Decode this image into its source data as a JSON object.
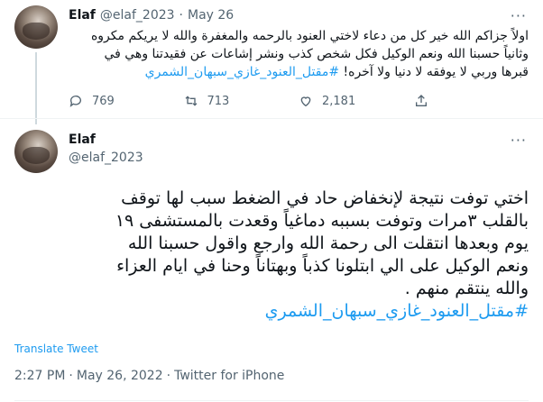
{
  "context_tweet": {
    "author_name": "Elaf",
    "handle": "@elaf_2023",
    "separator": "·",
    "date": "May 26",
    "more": "···",
    "lines": [
      "اولاً جزاكم الله خير كل من دعاء لاختي العنود بالرحمه والمغفرة والله لا يريكم مكروه",
      "وثانياً حسبنا الله ونعم الوكيل فكل شخص كذب ونشر إشاعات عن فقيدتنا وهي في",
      "قبرها وربي لا يوفقه لا دنيا ولا آخره!"
    ],
    "hashtag": "#مقتل_العنود_غازي_سبهان_الشمري",
    "replies": "769",
    "retweets": "713",
    "likes": "2,181"
  },
  "main_tweet": {
    "author_name": "Elaf",
    "handle": "@elaf_2023",
    "more": "···",
    "lines": [
      "اختي توفت نتيجة لإنخفاض حاد في الضغط سبب لها توقف",
      "بالقلب ٣مرات وتوفت بسببه دماغياً وقعدت بالمستشفى ١٩",
      "يوم وبعدها انتقلت الى رحمة الله وارجع واقول حسبنا الله",
      "ونعم الوكيل على الي ابتلونا كذباً وبهتاناً وحنا في ايام العزاء",
      "والله ينتقم منهم ."
    ],
    "hashtag": "#مقتل_العنود_غازي_سبهان_الشمري",
    "translate_label": "Translate Tweet",
    "time": "2:27 PM",
    "separator": "·",
    "date": "May 26, 2022",
    "client": "Twitter for iPhone"
  },
  "icons": {
    "reply": "reply-icon",
    "retweet": "retweet-icon",
    "like": "heart-icon",
    "share": "share-icon",
    "more": "more-icon"
  },
  "colors": {
    "link": "#1d9bf0",
    "muted": "#536471",
    "text": "#0f1419",
    "thread_line": "#cfd9de"
  }
}
